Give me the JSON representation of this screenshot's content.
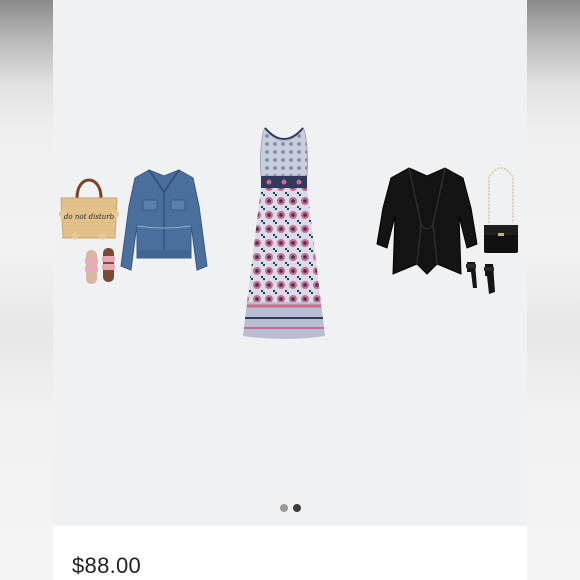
{
  "listing": {
    "price": "$88.00"
  },
  "carousel": {
    "dots": [
      {
        "active": false
      },
      {
        "active": true
      }
    ]
  },
  "tote_bag": {
    "text": "do not disturb"
  },
  "colors": {
    "background": "#f0f1f3",
    "card": "#ffffff",
    "price_text": "#222222",
    "denim": "#4a6f9c",
    "dress_navy": "#2f3a5e",
    "dress_pink": "#cf6a8a",
    "black_garment": "#141414",
    "straw": "#e2c28a",
    "sandal_pink": "#e7aab6",
    "dot_active": "#3c3c3c",
    "dot_inactive": "#9a9a9a"
  }
}
